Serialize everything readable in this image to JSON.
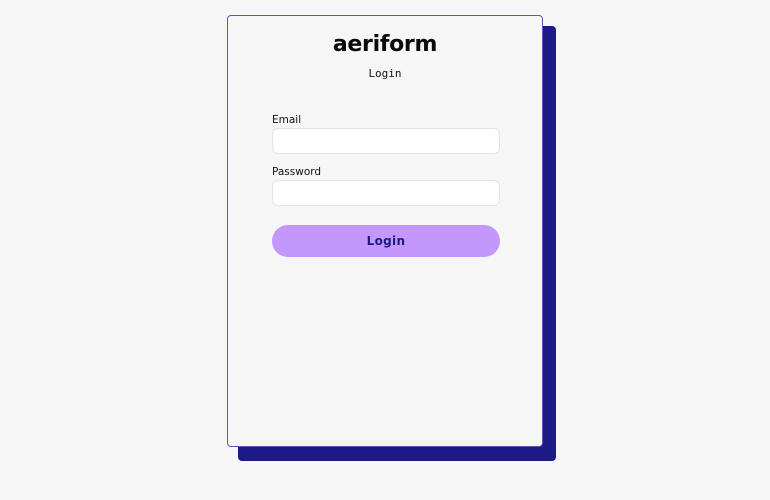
{
  "brand": {
    "name": "aeriform"
  },
  "form": {
    "subtitle": "Login",
    "email_label": "Email",
    "email_value": "",
    "email_placeholder": "",
    "password_label": "Password",
    "password_value": "",
    "password_placeholder": "",
    "submit_label": "Login"
  },
  "colors": {
    "background": "#f6f6f6",
    "card_border": "#5b57b8",
    "card_shadow": "#1e1a85",
    "button_fill": "#c497fc",
    "button_text": "#1e1a85"
  }
}
